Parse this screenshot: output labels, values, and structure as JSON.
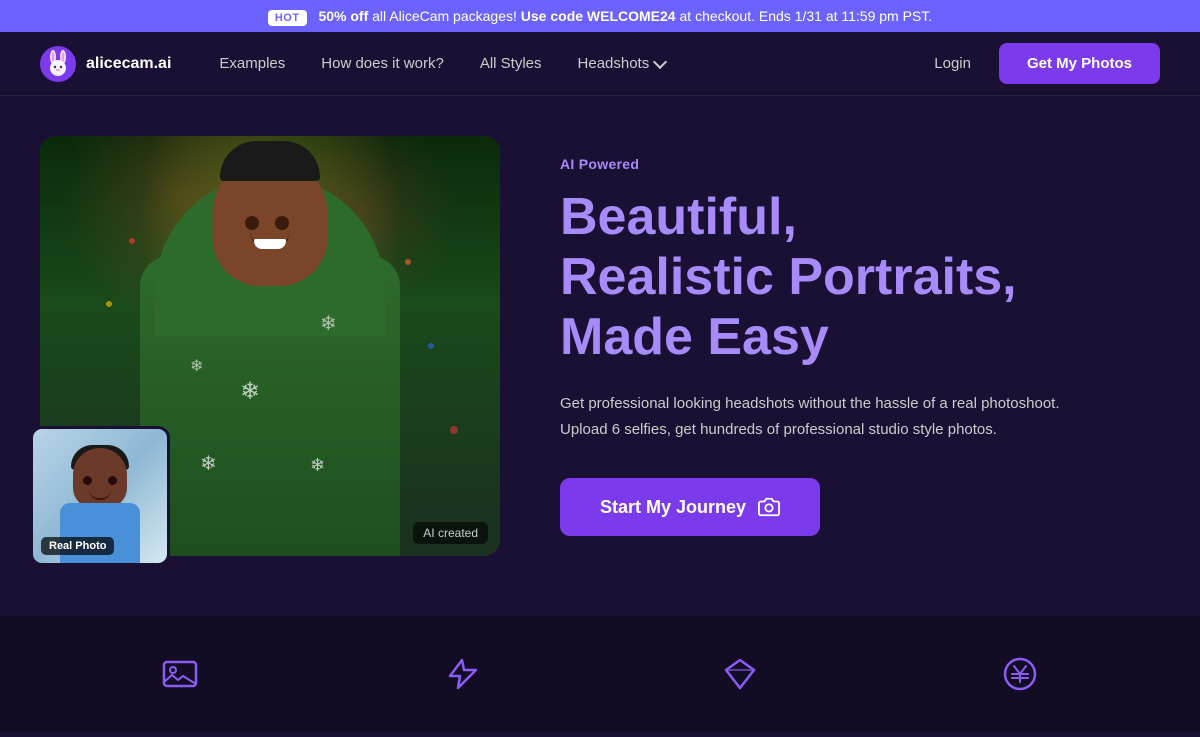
{
  "promo": {
    "hot_badge": "HOT",
    "text_before_code": "50% off all AliceCam packages! ",
    "bold_prefix": "50% off",
    "plain_prefix": " all AliceCam packages! ",
    "code": "Use code WELCOME24",
    "text_after": " at checkout. Ends 1/31 at 11:59 pm PST."
  },
  "nav": {
    "brand": "alicecam.ai",
    "links": [
      {
        "label": "Examples",
        "href": "#"
      },
      {
        "label": "How does it work?",
        "href": "#"
      },
      {
        "label": "All Styles",
        "href": "#"
      },
      {
        "label": "Headshots",
        "href": "#",
        "has_dropdown": true
      }
    ],
    "login_label": "Login",
    "cta_label": "Get My Photos"
  },
  "hero": {
    "ai_powered_label": "AI Powered",
    "headline_line1": "Beautiful,",
    "headline_line2": "Realistic Portraits,",
    "headline_line3": "Made Easy",
    "description_line1": "Get professional looking headshots without the hassle of a real photoshoot.",
    "description_line2": "Upload 6 selfies, get hundreds of professional studio style photos.",
    "cta_label": "Start My Journey",
    "real_photo_label": "Real Photo",
    "ai_created_label": "AI created"
  },
  "bottom_icons": [
    {
      "name": "image-icon",
      "symbol": "image"
    },
    {
      "name": "lightning-icon",
      "symbol": "lightning"
    },
    {
      "name": "diamond-icon",
      "symbol": "diamond"
    },
    {
      "name": "yen-icon",
      "symbol": "yen"
    }
  ],
  "colors": {
    "accent": "#7c3aed",
    "accent_light": "#a78bfa",
    "banner_bg": "#6c63ff",
    "bg_dark": "#1a1033",
    "bg_darker": "#120d24"
  }
}
